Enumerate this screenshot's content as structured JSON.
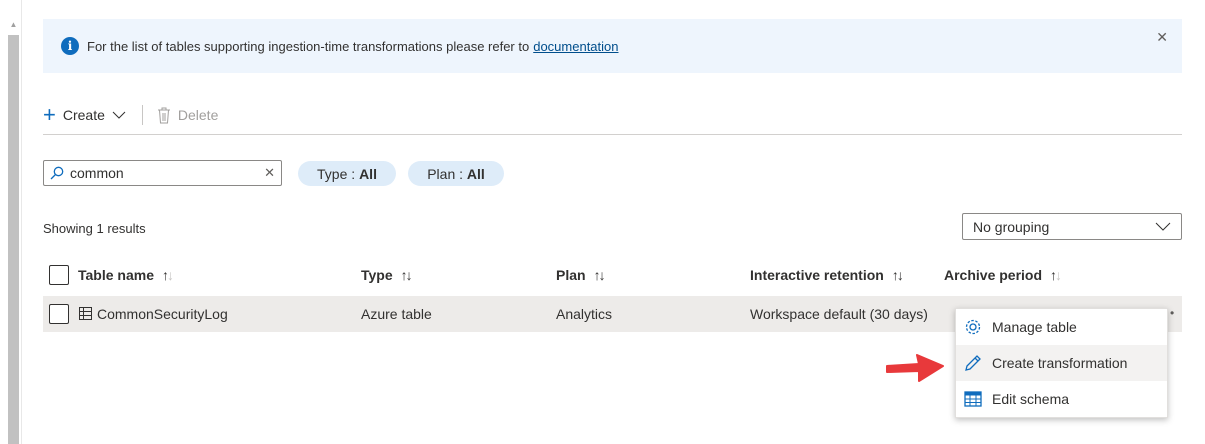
{
  "info_bar": {
    "text": "For the list of tables supporting ingestion-time transformations please refer to",
    "link": "documentation"
  },
  "toolbar": {
    "create_label": "Create",
    "delete_label": "Delete"
  },
  "search": {
    "value": "common"
  },
  "filters": [
    {
      "label": "Type : ",
      "value": "All"
    },
    {
      "label": "Plan : ",
      "value": "All"
    }
  ],
  "results_text": "Showing 1 results",
  "grouping": {
    "selected": "No grouping"
  },
  "table": {
    "columns": [
      "Table name",
      "Type",
      "Plan",
      "Interactive retention",
      "Archive period"
    ],
    "rows": [
      {
        "name": "CommonSecurityLog",
        "type": "Azure table",
        "plan": "Analytics",
        "retention": "Workspace default (30 days)",
        "archive": ""
      }
    ]
  },
  "context_menu": {
    "items": [
      {
        "label": "Manage table",
        "icon": "gear-icon"
      },
      {
        "label": "Create transformation",
        "icon": "pencil-icon"
      },
      {
        "label": "Edit schema",
        "icon": "table-grid-icon"
      }
    ]
  },
  "colors": {
    "accent": "#0f6cbd",
    "annotation_arrow": "#e8393b",
    "info_bg": "#eef5fd",
    "pill_bg": "#deecf9"
  }
}
